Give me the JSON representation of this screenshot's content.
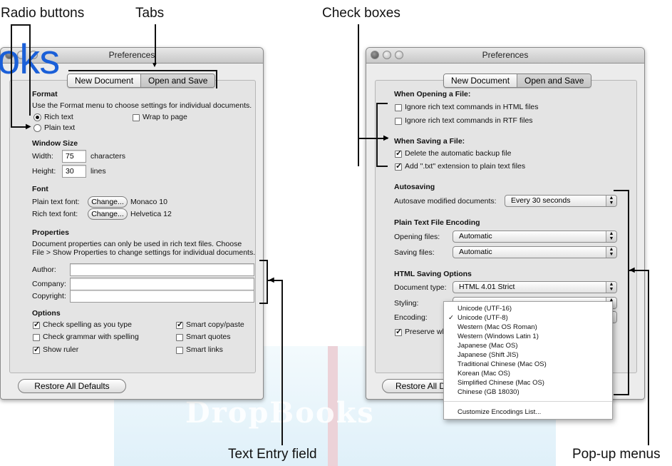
{
  "callouts": {
    "radio_buttons": "Radio buttons",
    "tabs": "Tabs",
    "check_boxes": "Check boxes",
    "text_entry_field": "Text Entry field",
    "popup_menus": "Pop-up menus"
  },
  "watermark": {
    "left": "oks",
    "center": "DropBooks"
  },
  "left_window": {
    "title": "Preferences",
    "tabs": [
      "New Document",
      "Open and Save"
    ],
    "format": {
      "heading": "Format",
      "desc": "Use the Format menu to choose settings for individual documents.",
      "rich_text": "Rich text",
      "plain_text": "Plain text",
      "wrap_to_page": "Wrap to page"
    },
    "window_size": {
      "heading": "Window Size",
      "width_label": "Width:",
      "width_value": "75",
      "width_unit": "characters",
      "height_label": "Height:",
      "height_value": "30",
      "height_unit": "lines"
    },
    "font": {
      "heading": "Font",
      "plain_label": "Plain text font:",
      "plain_button": "Change...",
      "plain_value": "Monaco 10",
      "rich_label": "Rich text font:",
      "rich_button": "Change...",
      "rich_value": "Helvetica 12"
    },
    "properties": {
      "heading": "Properties",
      "desc1": "Document properties can only be used in rich text files. Choose",
      "desc2": "File > Show Properties to change settings for individual documents.",
      "author": "Author:",
      "company": "Company:",
      "copyright": "Copyright:"
    },
    "options": {
      "heading": "Options",
      "check_spelling": "Check spelling as you type",
      "check_grammar": "Check grammar with spelling",
      "show_ruler": "Show ruler",
      "smart_copy": "Smart copy/paste",
      "smart_quotes": "Smart quotes",
      "smart_links": "Smart links"
    },
    "restore": "Restore All Defaults"
  },
  "right_window": {
    "title": "Preferences",
    "tabs": [
      "New Document",
      "Open and Save"
    ],
    "opening": {
      "heading": "When Opening a File:",
      "ignore_html": "Ignore rich text commands in HTML files",
      "ignore_rtf": "Ignore rich text commands in RTF files"
    },
    "saving": {
      "heading": "When Saving a File:",
      "delete_backup": "Delete the automatic backup file",
      "add_txt": "Add \".txt\" extension to plain text files"
    },
    "autosaving": {
      "heading": "Autosaving",
      "label": "Autosave modified documents:",
      "value": "Every 30 seconds"
    },
    "encoding": {
      "heading": "Plain Text File Encoding",
      "opening_label": "Opening files:",
      "opening_value": "Automatic",
      "saving_label": "Saving files:",
      "saving_value": "Automatic"
    },
    "html": {
      "heading": "HTML Saving Options",
      "doctype_label": "Document type:",
      "doctype_value": "HTML 4.01 Strict",
      "styling_label": "Styling:",
      "encoding_label": "Encoding:",
      "preserve": "Preserve wh"
    },
    "restore": "Restore All D",
    "encoding_menu": {
      "items": [
        "Unicode (UTF-16)",
        "Unicode (UTF-8)",
        "Western (Mac OS Roman)",
        "Western (Windows Latin 1)",
        "Japanese (Mac OS)",
        "Japanese (Shift JIS)",
        "Traditional Chinese (Mac OS)",
        "Korean (Mac OS)",
        "Simplified Chinese (Mac OS)",
        "Chinese (GB 18030)"
      ],
      "selected": "Unicode (UTF-8)",
      "customize": "Customize Encodings List..."
    }
  }
}
